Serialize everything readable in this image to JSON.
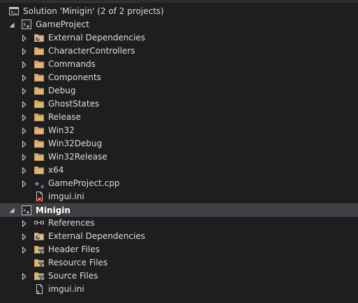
{
  "solution": {
    "label": "Solution 'Minigin' (2 of 2 projects)"
  },
  "projects": [
    {
      "name": "GameProject",
      "expanded": true,
      "selected": false,
      "items": [
        {
          "label": "External Dependencies",
          "icon": "external-dependencies-icon",
          "expandable": true
        },
        {
          "label": "CharacterControllers",
          "icon": "folder-icon",
          "expandable": true
        },
        {
          "label": "Commands",
          "icon": "folder-icon",
          "expandable": true
        },
        {
          "label": "Components",
          "icon": "folder-icon",
          "expandable": true
        },
        {
          "label": "Debug",
          "icon": "folder-icon",
          "expandable": true
        },
        {
          "label": "GhostStates",
          "icon": "folder-icon",
          "expandable": true
        },
        {
          "label": "Release",
          "icon": "folder-icon",
          "expandable": true
        },
        {
          "label": "Win32",
          "icon": "folder-icon",
          "expandable": true
        },
        {
          "label": "Win32Debug",
          "icon": "folder-icon",
          "expandable": true
        },
        {
          "label": "Win32Release",
          "icon": "folder-icon",
          "expandable": true
        },
        {
          "label": "x64",
          "icon": "folder-icon",
          "expandable": true
        },
        {
          "label": "GameProject.cpp",
          "icon": "cpp-file-icon",
          "expandable": true
        },
        {
          "label": "imgui.ini",
          "icon": "ini-file-excluded-icon",
          "expandable": false
        }
      ]
    },
    {
      "name": "Minigin",
      "expanded": true,
      "selected": true,
      "items": [
        {
          "label": "References",
          "icon": "references-icon",
          "expandable": true
        },
        {
          "label": "External Dependencies",
          "icon": "external-dependencies-icon",
          "expandable": true
        },
        {
          "label": "Header Files",
          "icon": "filter-folder-icon",
          "expandable": true
        },
        {
          "label": "Resource Files",
          "icon": "filter-folder-icon",
          "expandable": false
        },
        {
          "label": "Source Files",
          "icon": "filter-folder-icon",
          "expandable": true
        },
        {
          "label": "imgui.ini",
          "icon": "ini-file-icon",
          "expandable": false
        }
      ]
    }
  ],
  "colors": {
    "background": "#1e1e1e",
    "selected_row": "#3f3f46",
    "text": "#dcdcdc",
    "folder": "#dcb67a",
    "project_accent": "#b180d7",
    "filter_blue": "#3794ff",
    "error_red": "#e51400"
  }
}
